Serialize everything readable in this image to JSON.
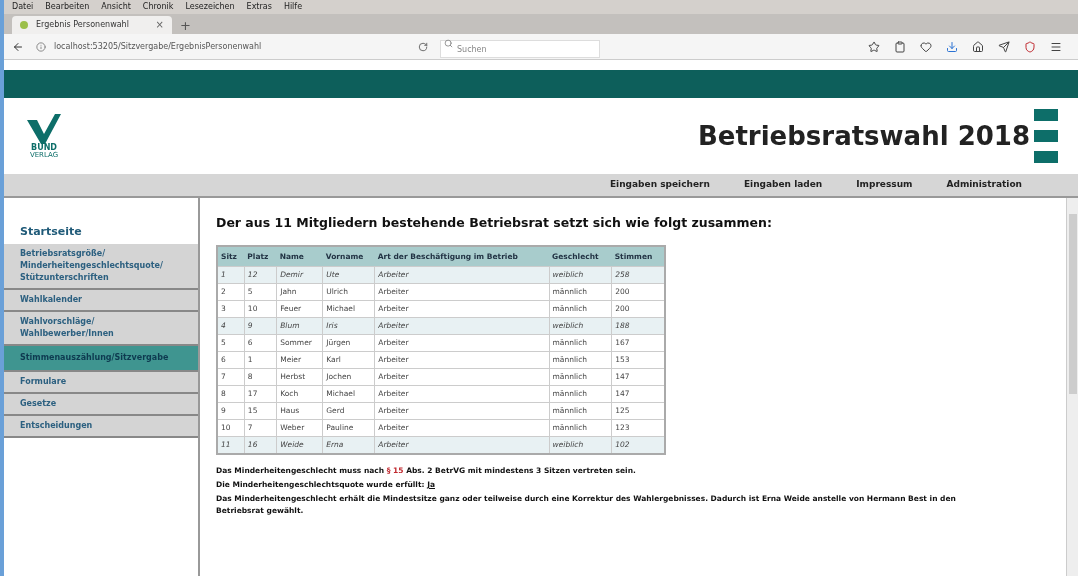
{
  "browser": {
    "menu": [
      "Datei",
      "Bearbeiten",
      "Ansicht",
      "Chronik",
      "Lesezeichen",
      "Extras",
      "Hilfe"
    ],
    "tab": {
      "title": "Ergebnis Personenwahl",
      "close": "×",
      "new_tab": "+"
    },
    "url": "localhost:53205/Sitzvergabe/ErgebnisPersonenwahl",
    "search_placeholder": "Suchen"
  },
  "header": {
    "logo_line1": "BUND",
    "logo_line2": "VERLAG",
    "title": "Betriebsratswahl 2018"
  },
  "top_nav": [
    "Eingaben speichern",
    "Eingaben laden",
    "Impressum",
    "Administration"
  ],
  "sidebar": {
    "home": "Startseite",
    "items": [
      {
        "label": "Betriebsratsgröße/ Minderheitengeschlechtsquote/ Stützunterschriften",
        "selected": false
      },
      {
        "label": "Wahlkalender",
        "selected": false
      },
      {
        "label": "Wahlvorschläge/ Wahlbewerber/Innen",
        "selected": false
      },
      {
        "label": "Stimmenauszählung/Sitzvergabe",
        "selected": true
      },
      {
        "label": "Formulare",
        "selected": false
      },
      {
        "label": "Gesetze",
        "selected": false
      },
      {
        "label": "Entscheidungen",
        "selected": false
      }
    ]
  },
  "content": {
    "heading": "Der aus 11 Mitgliedern bestehende Betriebsrat setzt sich wie folgt zusammen:",
    "table": {
      "columns": [
        "Sitz",
        "Platz",
        "Name",
        "Vorname",
        "Art der Beschäftigung im Betrieb",
        "Geschlecht",
        "Stimmen"
      ],
      "rows": [
        {
          "cells": [
            "1",
            "12",
            "Demir",
            "Ute",
            "Arbeiter",
            "weiblich",
            "258"
          ],
          "highlighted": true
        },
        {
          "cells": [
            "2",
            "5",
            "Jahn",
            "Ulrich",
            "Arbeiter",
            "männlich",
            "200"
          ],
          "highlighted": false
        },
        {
          "cells": [
            "3",
            "10",
            "Feuer",
            "Michael",
            "Arbeiter",
            "männlich",
            "200"
          ],
          "highlighted": false
        },
        {
          "cells": [
            "4",
            "9",
            "Blum",
            "Iris",
            "Arbeiter",
            "weiblich",
            "188"
          ],
          "highlighted": true
        },
        {
          "cells": [
            "5",
            "6",
            "Sommer",
            "Jürgen",
            "Arbeiter",
            "männlich",
            "167"
          ],
          "highlighted": false
        },
        {
          "cells": [
            "6",
            "1",
            "Meier",
            "Karl",
            "Arbeiter",
            "männlich",
            "153"
          ],
          "highlighted": false
        },
        {
          "cells": [
            "7",
            "8",
            "Herbst",
            "Jochen",
            "Arbeiter",
            "männlich",
            "147"
          ],
          "highlighted": false
        },
        {
          "cells": [
            "8",
            "17",
            "Koch",
            "Michael",
            "Arbeiter",
            "männlich",
            "147"
          ],
          "highlighted": false
        },
        {
          "cells": [
            "9",
            "15",
            "Haus",
            "Gerd",
            "Arbeiter",
            "männlich",
            "125"
          ],
          "highlighted": false
        },
        {
          "cells": [
            "10",
            "7",
            "Weber",
            "Pauline",
            "Arbeiter",
            "männlich",
            "123"
          ],
          "highlighted": false
        },
        {
          "cells": [
            "11",
            "16",
            "Weide",
            "Erna",
            "Arbeiter",
            "weiblich",
            "102"
          ],
          "highlighted": true
        }
      ]
    },
    "notes": [
      {
        "before": "Das Minderheitengeschlecht muss nach ",
        "link": "§ 15",
        "after": " Abs. 2 BetrVG mit mindestens 3 Sitzen vertreten sein.",
        "kind": "law"
      },
      {
        "before": "Die Minderheitengeschlechtsquote wurde erfüllt: ",
        "link": "Ja",
        "kind": "answer"
      },
      {
        "before": "Das Minderheitengeschlecht erhält die Mindestsitze ganz oder teilweise durch eine Korrektur des Wahlergebnisses. Dadurch ist Erna Weide anstelle von Hermann Best in den Betriebsrat gewählt.",
        "kind": "plain"
      }
    ]
  }
}
